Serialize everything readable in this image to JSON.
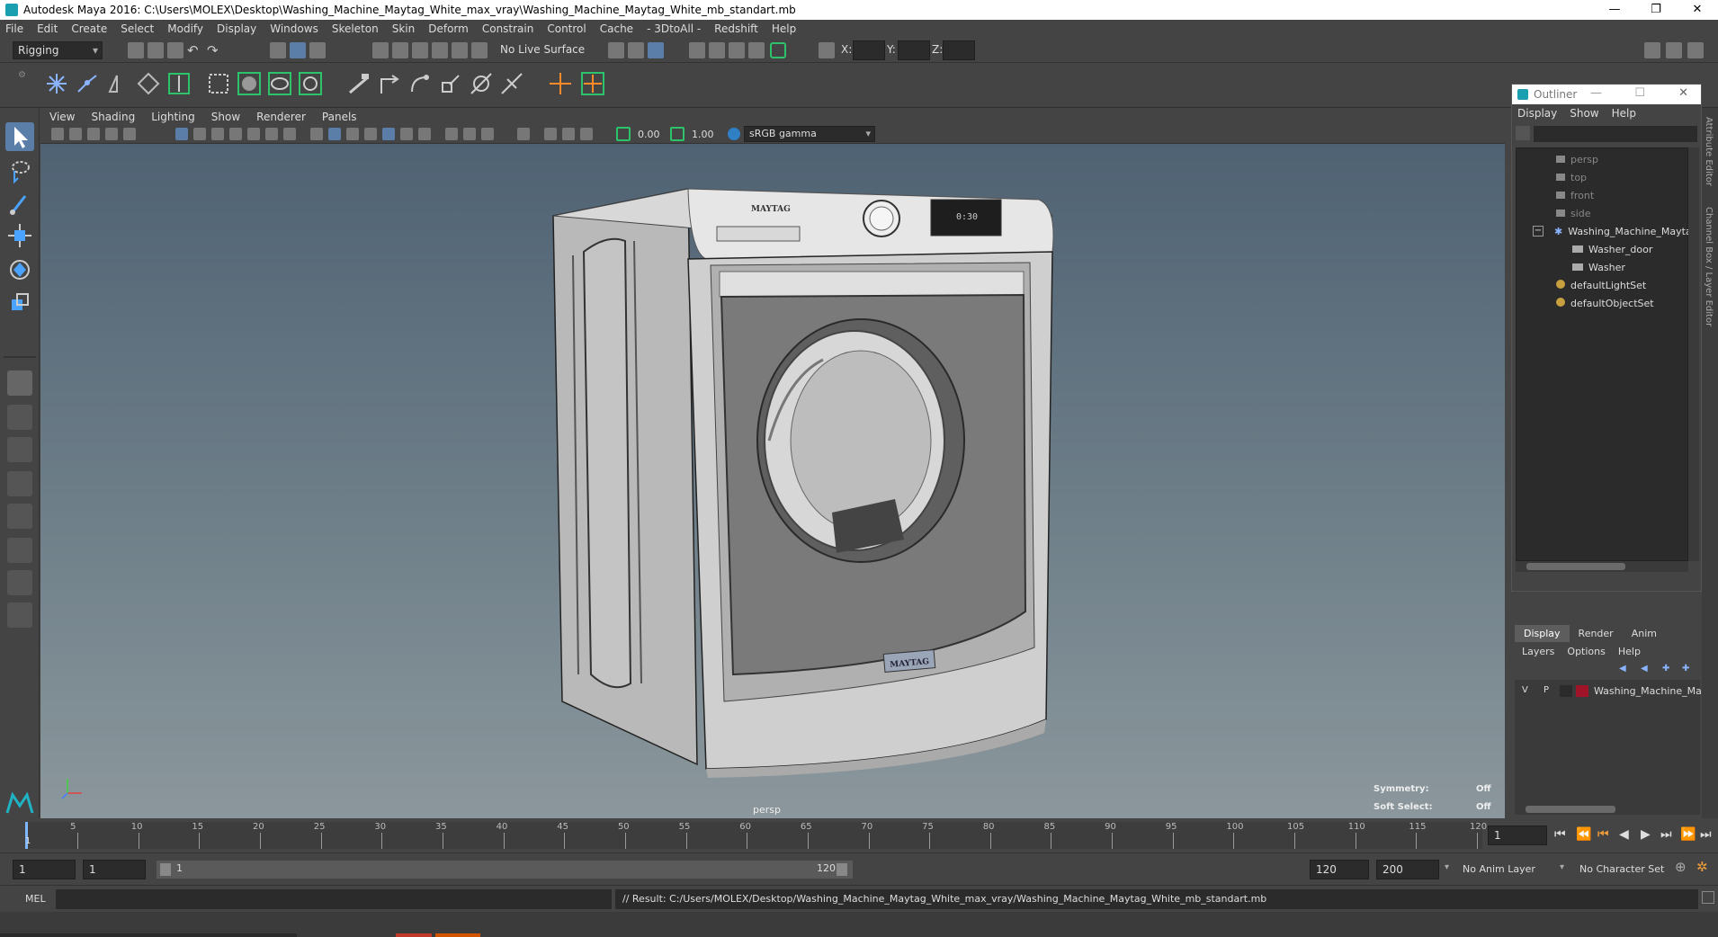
{
  "window": {
    "title": "Autodesk Maya 2016: C:\\Users\\MOLEX\\Desktop\\Washing_Machine_Maytag_White_max_vray\\Washing_Machine_Maytag_White_mb_standart.mb",
    "minimize": "—",
    "restore": "❐",
    "close": "✕"
  },
  "menubar": [
    "File",
    "Edit",
    "Create",
    "Select",
    "Modify",
    "Display",
    "Windows",
    "Skeleton",
    "Skin",
    "Deform",
    "Constrain",
    "Control",
    "Cache",
    "- 3DtoAll -",
    "Redshift",
    "Help"
  ],
  "statusline": {
    "menuset": "Rigging",
    "live_surface": "No Live Surface",
    "x_label": "X:",
    "y_label": "Y:",
    "z_label": "Z:"
  },
  "viewport": {
    "menu": [
      "View",
      "Shading",
      "Lighting",
      "Show",
      "Renderer",
      "Panels"
    ],
    "exposure": "0.00",
    "gamma": "1.00",
    "color_space": "sRGB gamma",
    "camera_label": "persp",
    "symmetry_label": "Symmetry:",
    "symmetry_value": "Off",
    "soft_select_label": "Soft Select:",
    "soft_select_value": "Off",
    "model": {
      "brand_top": "MAYTAG",
      "brand_front": "MAYTAG",
      "display_time": "0:30"
    }
  },
  "outliner": {
    "title": "Outliner",
    "menu": [
      "Display",
      "Show",
      "Help"
    ],
    "items": [
      {
        "label": "persp",
        "dim": true
      },
      {
        "label": "top",
        "dim": true
      },
      {
        "label": "front",
        "dim": true
      },
      {
        "label": "side",
        "dim": true
      },
      {
        "label": "Washing_Machine_Mayta",
        "dim": false
      },
      {
        "label": "Washer_door",
        "dim": false
      },
      {
        "label": "Washer",
        "dim": false
      },
      {
        "label": "defaultLightSet",
        "dim": false
      },
      {
        "label": "defaultObjectSet",
        "dim": false
      }
    ]
  },
  "channel_box_tabs": [
    "Attribute Editor",
    "Channel Box / Layer Editor"
  ],
  "layers": {
    "tabs": [
      "Display",
      "Render",
      "Anim"
    ],
    "menu": [
      "Layers",
      "Options",
      "Help"
    ],
    "row": {
      "v": "V",
      "p": "P",
      "name": "Washing_Machine_Ma",
      "color": "#a0142a"
    }
  },
  "timeline": {
    "ticks": [
      "5",
      "10",
      "15",
      "20",
      "25",
      "30",
      "35",
      "40",
      "45",
      "50",
      "55",
      "60",
      "65",
      "70",
      "75",
      "80",
      "85",
      "90",
      "95",
      "100",
      "105",
      "110",
      "115",
      "120"
    ],
    "start_marker": "1",
    "current_frame": "1"
  },
  "range": {
    "start": "1",
    "playback_start": "1",
    "slider_start": "1",
    "slider_end": "120",
    "playback_end": "120",
    "end": "200",
    "anim_layer": "No Anim Layer",
    "character_set": "No Character Set"
  },
  "cmdline": {
    "mode": "MEL",
    "result": "// Result: C:/Users/MOLEX/Desktop/Washing_Machine_Maytag_White_max_vray/Washing_Machine_Maytag_White_mb_standart.mb"
  }
}
